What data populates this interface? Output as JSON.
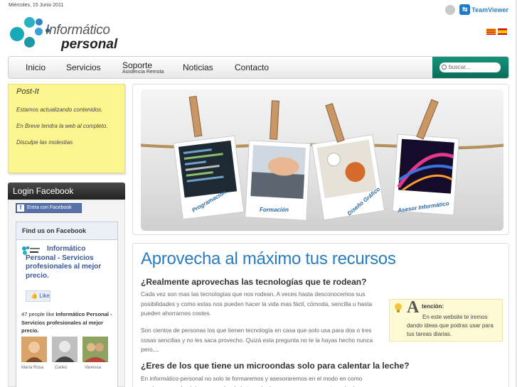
{
  "header": {
    "date": "Miércoles, 15 Junio 2011",
    "teamviewer_label": "TeamViewer",
    "logo_line1": "Informático",
    "logo_line2": "personal"
  },
  "nav": {
    "items": [
      {
        "label": "Inicio",
        "sub": ""
      },
      {
        "label": "Servicios",
        "sub": ""
      },
      {
        "label": "Soporte",
        "sub": "Asistencia Remota"
      },
      {
        "label": "Noticias",
        "sub": ""
      },
      {
        "label": "Contacto",
        "sub": ""
      }
    ],
    "search_placeholder": "buscar..."
  },
  "postit": {
    "title": "Post-It",
    "lines": [
      "Estamos actualizando contenidos.",
      "En Breve tendra la web al completo.",
      "Disculpe las molestias"
    ]
  },
  "login_facebook": {
    "title": "Login Facebook",
    "button": "Entra con Facebook",
    "fb_f": "f"
  },
  "fb_box": {
    "header": "Find us on Facebook",
    "page_name": "Informático Personal - Servicios profesionales al mejor precio.",
    "like": "Like",
    "people_count": "47 people like",
    "people_page": "Informático Personal - Servicios profesionales al mejor precio.",
    "faces": [
      "María Rosa",
      "Carles",
      "Vanessa"
    ]
  },
  "banner": {
    "photos": [
      "Programación",
      "Formación",
      "Diseño Gráfico",
      "Asesor Informático"
    ]
  },
  "content": {
    "title": "Aprovecha al máximo tus recursos",
    "h2_1": "¿Realmente aprovechas las tecnologías que te rodean?",
    "p1": "Cada vez son mas las tecnologías que nos rodean. A veces hasta desconocemos sus posibilidades y como estas nos pueden hacer la vida mas fácil, cómoda, sencilla u hasta pueden ahorrarnos costes.",
    "p2": "Son cientos de personas los que tienen tecnología en casa que solo usa para dos o tres cosas sencillas y no les saca provecho. Quizá esta pregunta no te la hayas hecho nunca pero,...",
    "h2_2": "¿Eres de los que tiene un microondas solo para calentar la leche?",
    "p3": "En informático-personal no solo te formaremos y asesoraremos en el modo en como puedes sacar el máximo provecho de la tecnología que ya posees, o en tecnología",
    "atencion_letter": "A",
    "atencion_label": "tención:",
    "atencion_text": "En este website te iremos dando ideas que podras usar para tus tareas diarias."
  },
  "colors": {
    "accent_blue": "#2a7cc1",
    "search_green": "#0f7f69",
    "postit_yellow": "#fdf690",
    "facebook_blue": "#3b5998"
  }
}
